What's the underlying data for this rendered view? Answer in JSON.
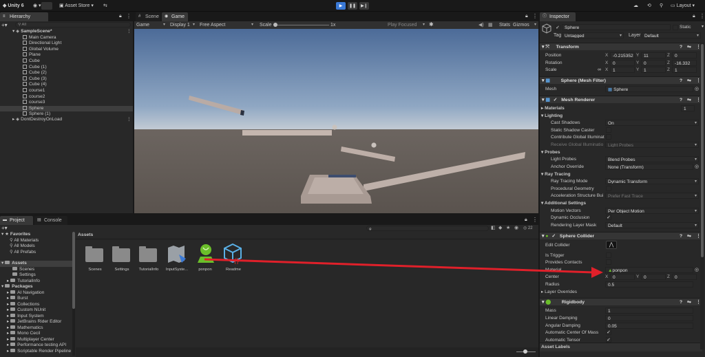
{
  "toolbar": {
    "app": "Unity 6",
    "asset_store": "Asset Store",
    "layout": "Layout"
  },
  "hierarchy": {
    "tab": "Hierarchy",
    "search_placeholder": "All",
    "scene": "SampleScene*",
    "items": [
      "Main Camera",
      "Directional Light",
      "Global Volume",
      "Plane",
      "Cube",
      "Cube (1)",
      "Cube (2)",
      "Cube (3)",
      "Cube (4)",
      "course1",
      "course2",
      "course3",
      "Sphere",
      "Sphere (1)"
    ],
    "dontdestroy": "DontDestroyOnLoad"
  },
  "scene_tabs": {
    "scene": "Scene",
    "game": "Game"
  },
  "game_bar": {
    "mode": "Game",
    "display": "Display 1",
    "aspect": "Free Aspect",
    "scale_label": "Scale",
    "scale_value": "1x",
    "play_focused": "Play Focused",
    "stats": "Stats",
    "gizmos": "Gizmos"
  },
  "bottom_tabs": {
    "project": "Project",
    "console": "Console"
  },
  "project": {
    "badge": "22",
    "favorites": "Favorites",
    "fav_items": [
      "All Materials",
      "All Models",
      "All Prefabs"
    ],
    "assets": "Assets",
    "asset_items": [
      "Scenes",
      "Settings",
      "TutorialInfo"
    ],
    "packages": "Packages",
    "package_items": [
      "AI Navigation",
      "Burst",
      "Collections",
      "Custom NUnit",
      "Input System",
      "JetBrains Rider Editor",
      "Mathematics",
      "Mono Cecil",
      "Multiplayer Center",
      "Performance testing API",
      "Scriptable Render Pipeline"
    ],
    "breadcrumb": "Assets",
    "grid": [
      "Scenes",
      "Settings",
      "TutorialInfo",
      "InputSyste...",
      "ponpon",
      "Readme"
    ]
  },
  "inspector": {
    "tab": "Inspector",
    "name": "Sphere",
    "static": "Static",
    "tag_label": "Tag",
    "tag": "Untagged",
    "layer_label": "Layer",
    "layer": "Default",
    "transform": {
      "title": "Transform",
      "position_label": "Position",
      "rotation_label": "Rotation",
      "scale_label": "Scale",
      "position": [
        "-0.215352",
        "11",
        "0"
      ],
      "rotation": [
        "0",
        "0",
        "-16.332"
      ],
      "scale": [
        "1",
        "1",
        "1"
      ]
    },
    "mesh_filter": {
      "title": "Sphere (Mesh Filter)",
      "mesh_label": "Mesh",
      "mesh": "Sphere"
    },
    "mesh_renderer": {
      "title": "Mesh Renderer",
      "materials": "Materials",
      "materials_count": "1",
      "lighting": "Lighting",
      "cast_shadows": "Cast Shadows",
      "cast_shadows_value": "On",
      "static_shadow": "Static Shadow Caster",
      "contribute_gi": "Contribute Global Illuminat",
      "receive_gi": "Receive Global Illuminatio",
      "receive_gi_value": "Light Probes",
      "probes": "Probes",
      "light_probes": "Light Probes",
      "light_probes_value": "Blend Probes",
      "anchor_override": "Anchor Override",
      "anchor_value": "None (Transform)",
      "ray_tracing": "Ray Tracing",
      "rt_mode": "Ray Tracing Mode",
      "rt_mode_value": "Dynamic Transform",
      "proc_geom": "Procedural Geometry",
      "accel": "Acceleration Structure Bui",
      "accel_value": "Prefer Fast Trace",
      "additional": "Additional Settings",
      "motion_vectors": "Motion Vectors",
      "motion_vectors_value": "Per Object Motion",
      "dynamic_occlusion": "Dynamic Occlusion",
      "layer_mask": "Rendering Layer Mask",
      "layer_mask_value": "Default"
    },
    "sphere_collider": {
      "title": "Sphere Collider",
      "edit": "Edit Collider",
      "is_trigger": "Is Trigger",
      "provides_contacts": "Provides Contacts",
      "material_label": "Material",
      "material": "ponpon",
      "center_label": "Center",
      "center": [
        "0",
        "0",
        "0"
      ],
      "radius_label": "Radius",
      "radius": "0.5",
      "layer_overrides": "Layer Overrides"
    },
    "rigidbody": {
      "title": "Rigidbody",
      "mass_label": "Mass",
      "mass": "1",
      "lin_damp_label": "Linear Damping",
      "lin_damp": "0",
      "ang_damp_label": "Angular Damping",
      "ang_damp": "0.05",
      "auto_com": "Automatic Center Of Mass",
      "auto_tensor": "Automatic Tensor"
    },
    "asset_labels": "Asset Labels"
  },
  "axes": {
    "x": "X",
    "y": "Y",
    "z": "Z"
  },
  "colors": {
    "annotation_arrow": "#e0202a",
    "accent": "#3a79d6"
  }
}
